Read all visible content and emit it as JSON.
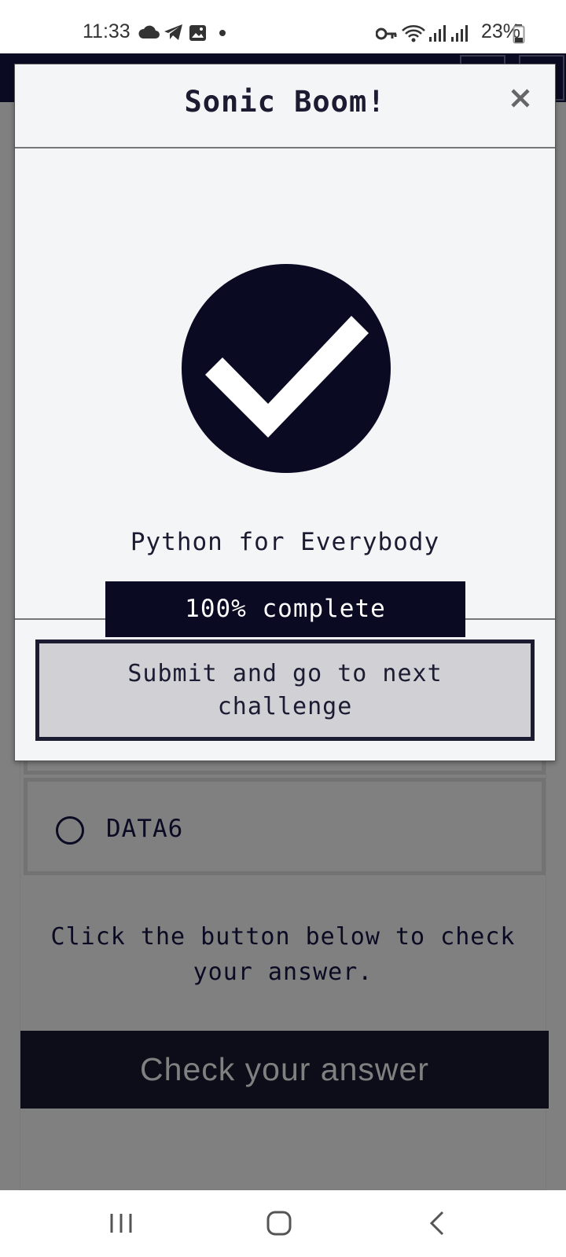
{
  "status_bar": {
    "time": "11:33",
    "battery": "23%",
    "icons": [
      "cloud-icon",
      "telegram-icon",
      "image-icon",
      "dot-icon",
      "vpn-key-icon",
      "wifi-icon",
      "signal-icon",
      "signal-icon",
      "battery-icon"
    ]
  },
  "modal": {
    "title": "Sonic Boom!",
    "close_icon": "close-icon",
    "success_icon": "check-circle-icon",
    "course_name": "Python for Everybody",
    "progress_text": "100% complete",
    "progress_percent": 100,
    "submit_label": "Submit and go to next challenge"
  },
  "page": {
    "option_label": "DATA6",
    "instruction": "Click the button below to check your answer.",
    "check_button_label": "Check your answer"
  },
  "nav_bar": {
    "icons": [
      "recent-apps-icon",
      "home-icon",
      "back-icon"
    ]
  },
  "colors": {
    "primary_dark": "#0a0a23",
    "modal_bg": "#f4f5f7",
    "submit_bg": "#d0d0d5",
    "overlay": "#808080"
  }
}
